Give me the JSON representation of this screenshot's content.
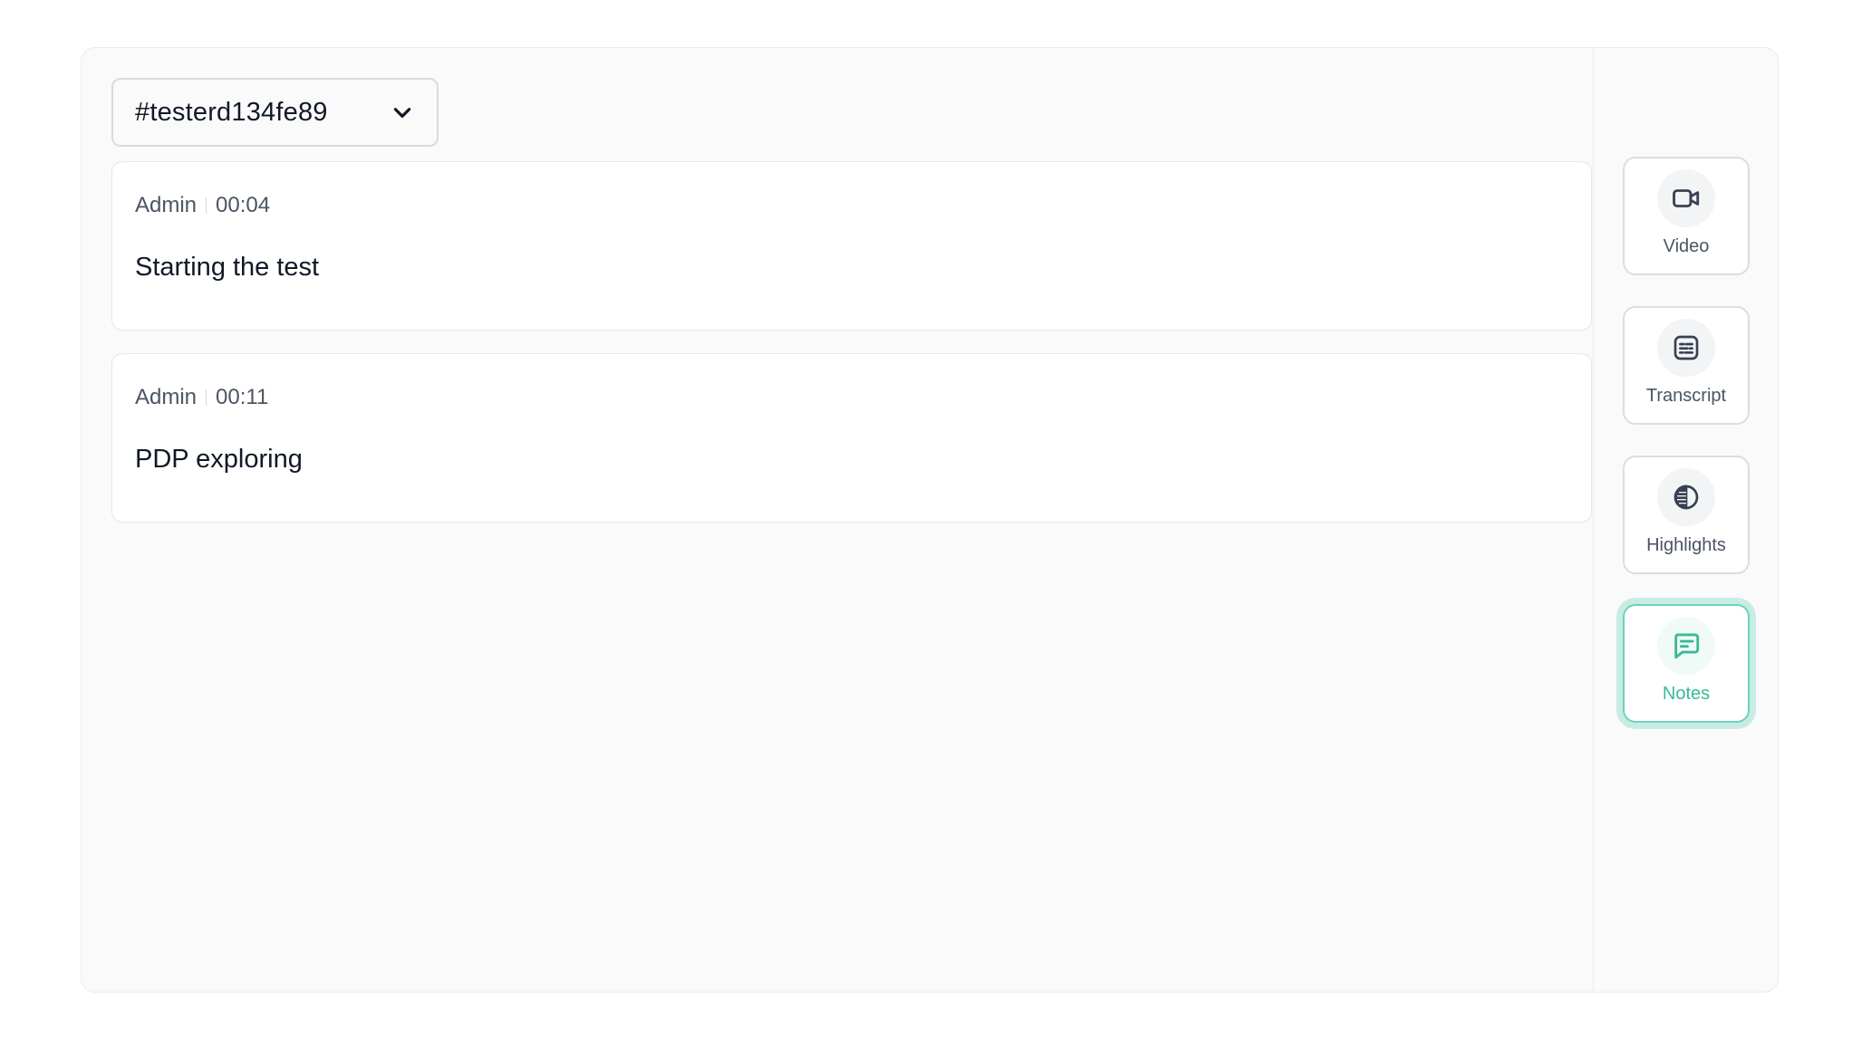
{
  "session_selector": {
    "value": "#testerd134fe89",
    "icon": "chevron-down-icon"
  },
  "notes": [
    {
      "author": "Admin",
      "time": "00:04",
      "text": "Starting the test"
    },
    {
      "author": "Admin",
      "time": "00:11",
      "text": "PDP exploring"
    }
  ],
  "rail": {
    "items": [
      {
        "label": "Video",
        "icon": "video-camera-icon",
        "active": false
      },
      {
        "label": "Transcript",
        "icon": "transcript-icon",
        "active": false
      },
      {
        "label": "Highlights",
        "icon": "highlights-icon",
        "active": false
      },
      {
        "label": "Notes",
        "icon": "chat-notes-icon",
        "active": true
      }
    ]
  },
  "colors": {
    "accent": "#3bb896",
    "accent_border": "#6dd3bc",
    "accent_glow": "#c9ece2",
    "panel_bg": "#fafafa",
    "icon_gray": "#374151"
  }
}
